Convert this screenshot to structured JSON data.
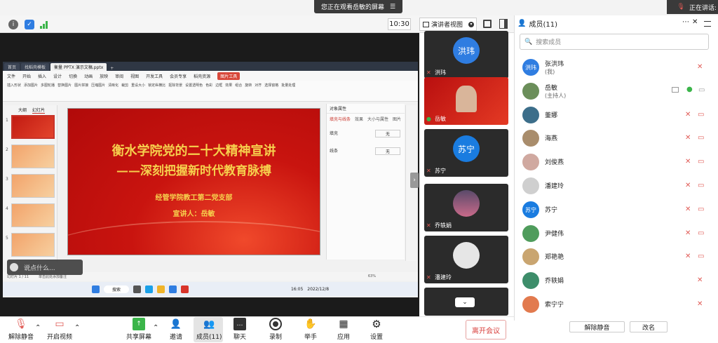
{
  "banner": {
    "sharing_text": "您正在观看岳敏的屏幕",
    "speaking_text": "正在讲话:"
  },
  "meeting_bar": {
    "timer": "10:30",
    "view_mode": "演讲者视图"
  },
  "wps": {
    "tabs": [
      "首页",
      "找稻壳模板",
      "衡量 PPTX 演示文稿.pptx"
    ],
    "menu": [
      "文件",
      "开始",
      "插入",
      "设计",
      "切换",
      "动画",
      "放映",
      "审阅",
      "视图",
      "开发工具",
      "会员专享",
      "稻壳资源",
      "图片工具"
    ],
    "ribbon": [
      "插入形状",
      "添加图片",
      "多图轮播",
      "替换图片",
      "图片拼接",
      "压缩图片",
      "清晰化",
      "裁剪",
      "重设大小",
      "锁定纵横比",
      "抠除背景",
      "设置透明色",
      "色彩",
      "边框",
      "效果",
      "组合",
      "旋转",
      "对齐",
      "选择窗格",
      "批量处理"
    ],
    "thumb_tabs": [
      "大纲",
      "幻灯片"
    ],
    "slide": {
      "title_line1": "衡水学院党的二十大精神宣讲",
      "title_line2": "——深刻把握新时代教育脉搏",
      "org": "经管学院教工第二党支部",
      "speaker": "宣讲人：岳敏"
    },
    "prop_panel": {
      "title": "对象属性",
      "tabs": [
        "填充与线条",
        "效果",
        "大小与属性",
        "图片"
      ],
      "fill_label": "填充",
      "line_label": "线条",
      "none": "无"
    },
    "status_left": "幻灯片 1 / 11",
    "status_note": "单击此处添加备注",
    "zoom": "63%",
    "taskbar_search": "搜索",
    "clock_time": "16:05",
    "clock_date": "2022/12/8"
  },
  "chat_placeholder": "说点什么...",
  "tiles": [
    {
      "name": "洪玮",
      "avatar_text": "洪玮",
      "color": "#2f7de1"
    },
    {
      "name": "岳敏",
      "avatar_text": "",
      "color": "#c8281c"
    },
    {
      "name": "苏宁",
      "avatar_text": "苏宁",
      "color": "#1a7ce0"
    },
    {
      "name": "乔轶娟",
      "avatar_text": "",
      "color": "#5a4a6a"
    },
    {
      "name": "潘建玲",
      "avatar_text": "",
      "color": "#d8d8d8"
    }
  ],
  "members_panel": {
    "title": "成员(11)",
    "search_placeholder": "搜索成员",
    "members": [
      {
        "name": "张洪玮",
        "sub": "(我)",
        "avatar_text": "洪玮",
        "color": "#2f7de1"
      },
      {
        "name": "岳敏",
        "sub": "(主持人)",
        "avatar_text": "",
        "color": "#6b8e5a"
      },
      {
        "name": "董娜",
        "sub": "",
        "avatar_text": "",
        "color": "#3c6e8a"
      },
      {
        "name": "海燕",
        "sub": "",
        "avatar_text": "",
        "color": "#a98d6c"
      },
      {
        "name": "刘俊燕",
        "sub": "",
        "avatar_text": "",
        "color": "#d0a9a0"
      },
      {
        "name": "潘建玲",
        "sub": "",
        "avatar_text": "",
        "color": "#cfcfcf"
      },
      {
        "name": "苏宁",
        "sub": "",
        "avatar_text": "苏宁",
        "color": "#1a7ce0"
      },
      {
        "name": "尹健伟",
        "sub": "",
        "avatar_text": "",
        "color": "#4f9c5c"
      },
      {
        "name": "郑艳艳",
        "sub": "",
        "avatar_text": "",
        "color": "#c9a570"
      },
      {
        "name": "乔轶娟",
        "sub": "",
        "avatar_text": "",
        "color": "#3d8d6a"
      },
      {
        "name": "索宁宁",
        "sub": "",
        "avatar_text": "",
        "color": "#e27a4e"
      }
    ],
    "unmute_all": "解除静音",
    "rename": "改名"
  },
  "toolbar": {
    "unmute": "解除静音",
    "video": "开启视频",
    "share": "共享屏幕",
    "invite": "邀请",
    "members": "成员(11)",
    "chat": "聊天",
    "record": "录制",
    "raise": "举手",
    "apps": "应用",
    "settings": "设置",
    "leave": "离开会议"
  },
  "colors": {
    "accent": "#2f7de1",
    "mute_red": "#e05a55",
    "leave_red": "#d9413e",
    "slide_red": "#c9140f",
    "slide_gold": "#f6d04d"
  }
}
